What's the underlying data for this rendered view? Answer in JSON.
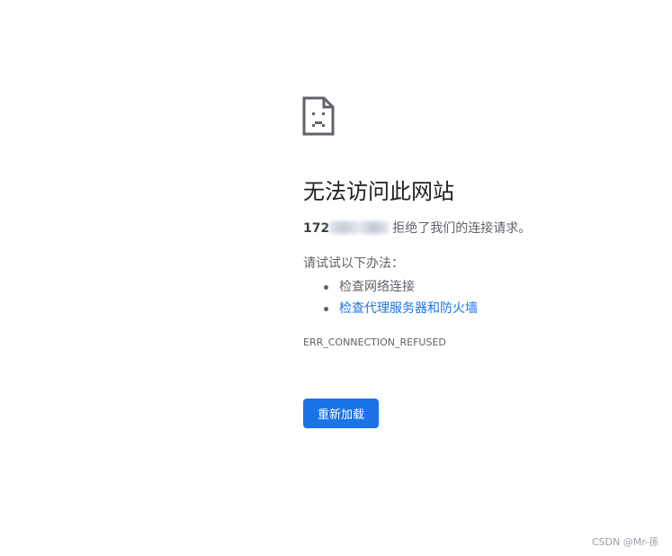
{
  "error": {
    "icon": "sad-document-icon",
    "title": "无法访问此网站",
    "host_prefix": "172",
    "message": "拒绝了我们的连接请求。",
    "suggestions_title": "请试试以下办法：",
    "suggestions": [
      {
        "label": "检查网络连接",
        "is_link": false
      },
      {
        "label": "检查代理服务器和防火墙",
        "is_link": true
      }
    ],
    "code": "ERR_CONNECTION_REFUSED",
    "reload_label": "重新加载"
  },
  "watermark": "CSDN @Mr-孫",
  "colors": {
    "accent": "#1a73e8",
    "text_primary": "#202124",
    "text_secondary": "#5f6368"
  }
}
